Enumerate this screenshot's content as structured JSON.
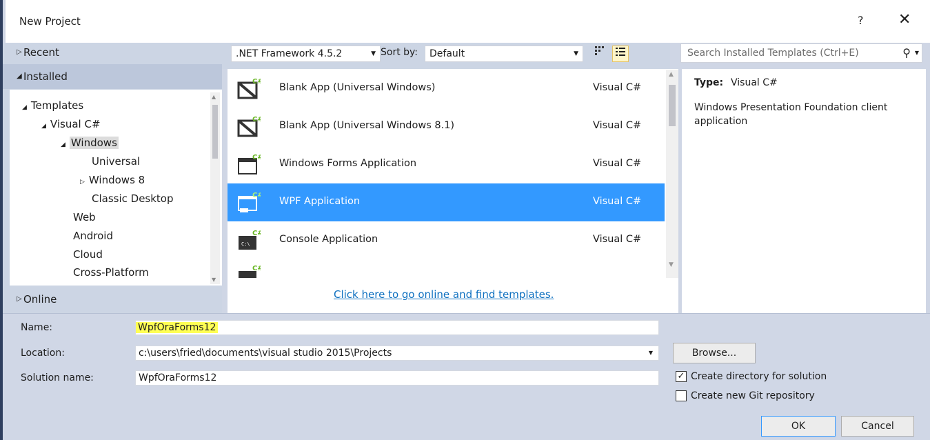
{
  "window": {
    "title": "New Project",
    "help": "?",
    "close": "✕"
  },
  "left_panel": {
    "recent": "Recent",
    "installed": "Installed",
    "online": "Online",
    "tree": {
      "templates": "Templates",
      "visual_csharp": "Visual C#",
      "windows": "Windows",
      "universal": "Universal",
      "windows8": "Windows 8",
      "classic_desktop": "Classic Desktop",
      "web": "Web",
      "android": "Android",
      "cloud": "Cloud",
      "cross_platform": "Cross-Platform"
    }
  },
  "toolbar": {
    "framework": ".NET Framework 4.5.2",
    "sort_label": "Sort by:",
    "sort_value": "Default"
  },
  "templates": [
    {
      "name": "Blank App (Universal Windows)",
      "lang": "Visual C#"
    },
    {
      "name": "Blank App (Universal Windows 8.1)",
      "lang": "Visual C#"
    },
    {
      "name": "Windows Forms Application",
      "lang": "Visual C#"
    },
    {
      "name": "WPF Application",
      "lang": "Visual C#"
    },
    {
      "name": "Console Application",
      "lang": "Visual C#"
    }
  ],
  "selected_template_index": 3,
  "online_link": "Click here to go online and find templates.",
  "search": {
    "placeholder": "Search Installed Templates (Ctrl+E)"
  },
  "details": {
    "type_label": "Type:",
    "type_value": "Visual C#",
    "description": "Windows Presentation Foundation client application"
  },
  "form": {
    "name_label": "Name:",
    "name_value": "WpfOraForms12",
    "location_label": "Location:",
    "location_value": "c:\\users\\fried\\documents\\visual studio 2015\\Projects",
    "solution_label": "Solution name:",
    "solution_value": "WpfOraForms12",
    "browse": "Browse...",
    "create_dir": "Create directory for solution",
    "create_dir_checked": true,
    "create_git": "Create new Git repository",
    "create_git_checked": false,
    "ok": "OK",
    "cancel": "Cancel"
  },
  "colors": {
    "selection": "#3399ff",
    "highlight": "#ffff55",
    "link": "#0e70c0",
    "csharp_green": "#68b723"
  }
}
